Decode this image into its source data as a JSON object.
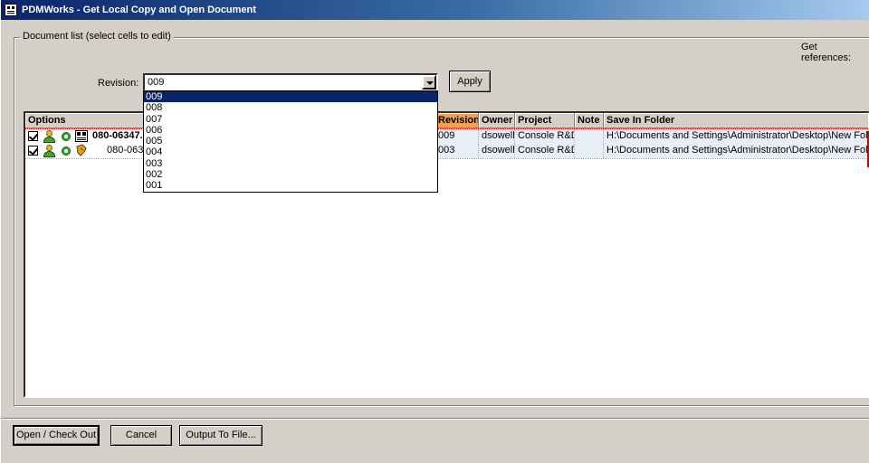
{
  "window": {
    "title": "PDMWorks - Get Local Copy and Open Document"
  },
  "group": {
    "label": "Document list (select cells to edit)"
  },
  "get_references_label": "Get references:",
  "revision": {
    "label": "Revision:",
    "selected": "009",
    "options": [
      "009",
      "008",
      "007",
      "006",
      "005",
      "004",
      "003",
      "002",
      "001"
    ],
    "apply_label": "Apply"
  },
  "table": {
    "columns": [
      "Options",
      "Revision",
      "Owner",
      "Project",
      "Note",
      "Save In Folder"
    ],
    "rows": [
      {
        "checked": true,
        "name": "080-06347.",
        "revision": "009",
        "owner": "dsowell",
        "project": "Console R&D",
        "note": "",
        "folder": "H:\\Documents and Settings\\Administrator\\Desktop\\New Folder"
      },
      {
        "checked": true,
        "name": "080-0634",
        "revision": "003",
        "owner": "dsowell",
        "project": "Console R&D",
        "note": "",
        "folder": "H:\\Documents and Settings\\Administrator\\Desktop\\New Folder"
      }
    ]
  },
  "buttons": {
    "open": "Open / Check Out",
    "cancel": "Cancel",
    "output": "Output To File..."
  },
  "colors": {
    "title_start": "#0a246a",
    "title_end": "#a6caf0",
    "sort_header": "#f0a050",
    "selected_item": "#0a246a"
  }
}
